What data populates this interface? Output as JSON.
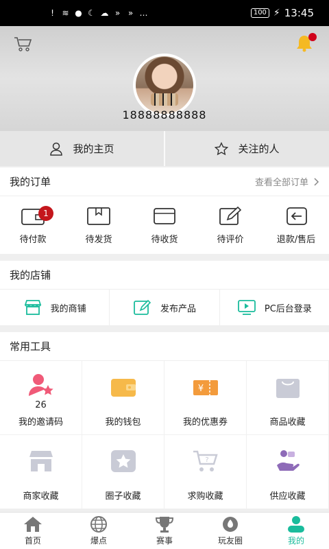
{
  "status_bar": {
    "time": "13:45",
    "battery": "100"
  },
  "header": {
    "phone": "18888888888"
  },
  "profile_tabs": [
    {
      "label": "我的主页",
      "icon": "user-icon"
    },
    {
      "label": "关注的人",
      "icon": "star-outline-icon"
    }
  ],
  "orders": {
    "title": "我的订单",
    "view_all": "查看全部订单",
    "items": [
      {
        "label": "待付款",
        "icon": "wallet-icon",
        "badge": "1"
      },
      {
        "label": "待发货",
        "icon": "box-icon"
      },
      {
        "label": "待收货",
        "icon": "card-icon"
      },
      {
        "label": "待评价",
        "icon": "edit-icon"
      },
      {
        "label": "退款/售后",
        "icon": "return-icon"
      }
    ]
  },
  "shop": {
    "title": "我的店铺",
    "items": [
      {
        "label": "我的商铺",
        "icon": "store-icon"
      },
      {
        "label": "发布产品",
        "icon": "edit-icon"
      },
      {
        "label": "PC后台登录",
        "icon": "monitor-icon"
      }
    ]
  },
  "tools": {
    "title": "常用工具",
    "items": [
      {
        "label": "我的邀请码",
        "icon": "invite-icon",
        "count": "26",
        "color": "#f05a78"
      },
      {
        "label": "我的钱包",
        "icon": "wallet-icon",
        "color": "#f6b94a"
      },
      {
        "label": "我的优惠券",
        "icon": "coupon-icon",
        "color": "#f39b3c"
      },
      {
        "label": "商品收藏",
        "icon": "bag-icon",
        "color": "#c9cbd6"
      },
      {
        "label": "商家收藏",
        "icon": "shop-icon",
        "color": "#c9cbd6"
      },
      {
        "label": "圈子收藏",
        "icon": "star-box-icon",
        "color": "#c9cbd6"
      },
      {
        "label": "求购收藏",
        "icon": "cart-question-icon",
        "color": "#c9cbd6"
      },
      {
        "label": "供应收藏",
        "icon": "hand-icon",
        "color": "#8e6bb8"
      }
    ]
  },
  "nav": [
    {
      "label": "首页",
      "icon": "home-icon"
    },
    {
      "label": "爆点",
      "icon": "globe-icon"
    },
    {
      "label": "赛事",
      "icon": "trophy-icon"
    },
    {
      "label": "玩友圈",
      "icon": "circle-icon"
    },
    {
      "label": "我的",
      "icon": "person-icon",
      "active": true
    }
  ],
  "colors": {
    "accent": "#1abc9c",
    "badge": "#c4161c"
  }
}
